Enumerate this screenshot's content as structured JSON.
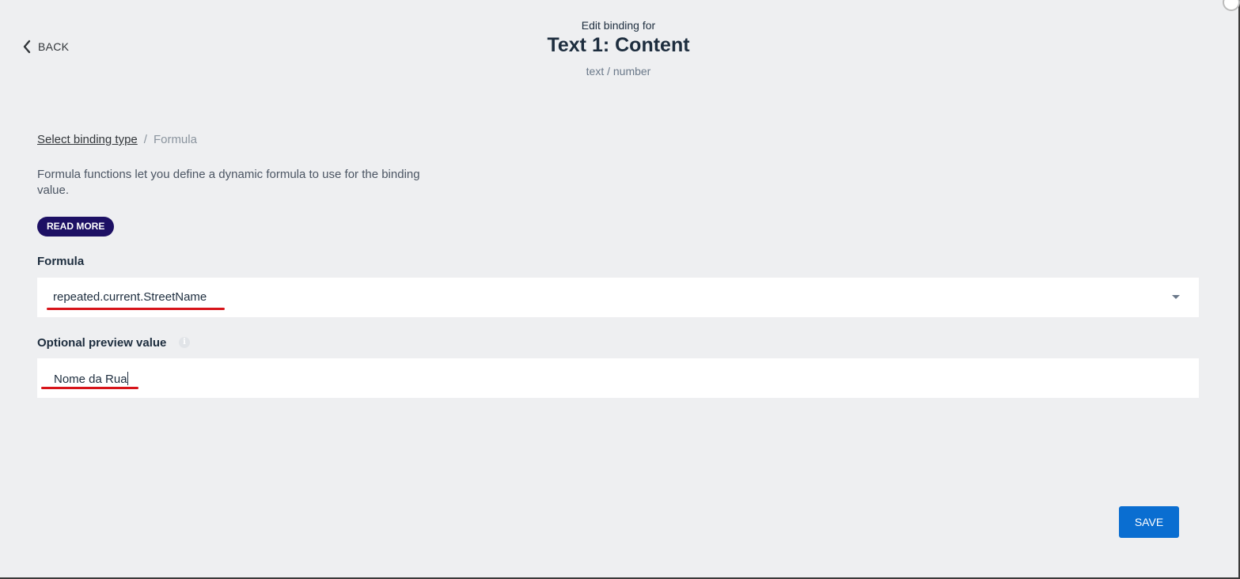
{
  "nav": {
    "back_label": "BACK"
  },
  "header": {
    "subtitle": "Edit binding for",
    "title": "Text 1: Content",
    "type": "text / number"
  },
  "breadcrumb": {
    "link": "Select binding type",
    "separator": "/",
    "current": "Formula"
  },
  "description": "Formula functions let you define a dynamic formula to use for the binding value.",
  "read_more_label": "READ MORE",
  "formula": {
    "label": "Formula",
    "value": "repeated.current.StreetName"
  },
  "preview": {
    "label": "Optional preview value",
    "info_glyph": "i",
    "value": "Nome da Rua"
  },
  "save_label": "SAVE",
  "colors": {
    "accent": "#0a6ed1",
    "read_more_bg": "#1d1064",
    "annotation": "#d7141a",
    "background": "#eeeff1"
  },
  "icons": [
    "chevron-left-icon",
    "dropdown-arrow-icon",
    "info-icon"
  ]
}
